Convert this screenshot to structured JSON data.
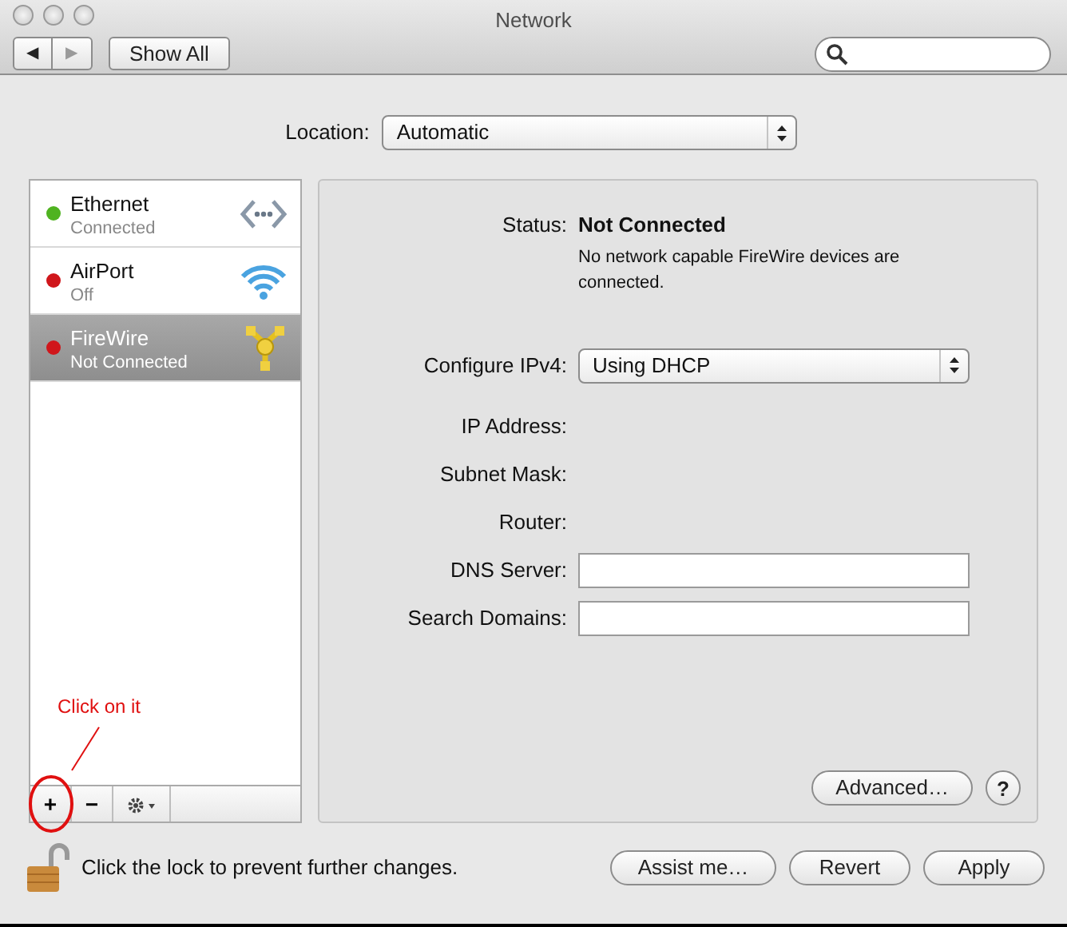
{
  "window": {
    "title": "Network"
  },
  "toolbar": {
    "back": "◀",
    "forward": "▶",
    "forward_disabled": true,
    "show_all": "Show All"
  },
  "location": {
    "label": "Location:",
    "value": "Automatic"
  },
  "services": [
    {
      "name": "Ethernet",
      "status": "Connected",
      "color": "#4fb320",
      "kind": "ethernet",
      "selected": false
    },
    {
      "name": "AirPort",
      "status": "Off",
      "color": "#d0161b",
      "kind": "wifi",
      "selected": false
    },
    {
      "name": "FireWire",
      "status": "Not Connected",
      "color": "#d0161b",
      "kind": "firewire",
      "selected": true
    }
  ],
  "list_buttons": [
    "+",
    "−"
  ],
  "details": {
    "status_label": "Status:",
    "status": "Not Connected",
    "status_note": "No network capable FireWire devices are connected.",
    "fields": [
      {
        "label": "Configure IPv4:",
        "kind": "select",
        "value": "Using DHCP"
      },
      {
        "label": "IP Address:",
        "kind": "text"
      },
      {
        "label": "Subnet Mask:",
        "kind": "text"
      },
      {
        "label": "Router:",
        "kind": "text"
      },
      {
        "label": "DNS Server:",
        "kind": "input"
      },
      {
        "label": "Search Domains:",
        "kind": "input"
      }
    ],
    "advanced": "Advanced…",
    "help": "?"
  },
  "lock": {
    "text": "Click the lock to prevent further changes.",
    "locked": false
  },
  "buttons": [
    "Assist me…",
    "Revert",
    "Apply"
  ],
  "annotation": {
    "text": "Click on it"
  }
}
